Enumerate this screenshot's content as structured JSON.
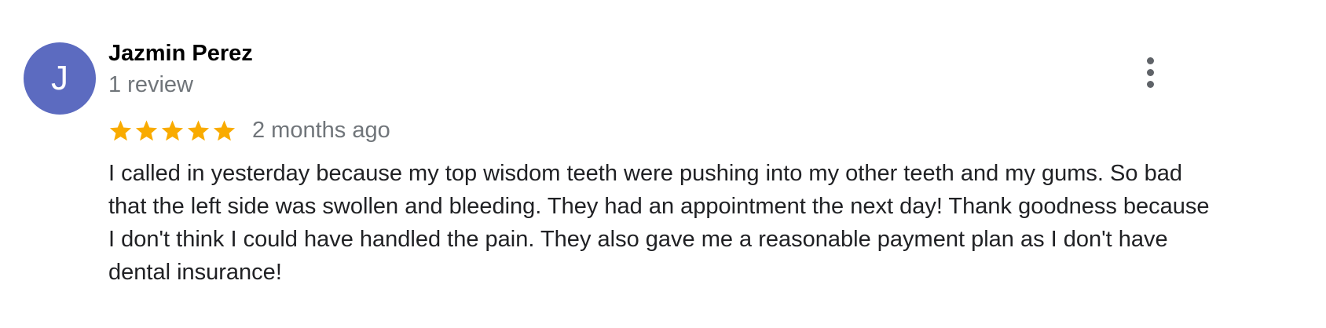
{
  "theme": {
    "avatar_color": "#5c6bc0",
    "star_color": "#f9ab00",
    "secondary_text_color": "#70757a"
  },
  "review": {
    "avatar_letter": "J",
    "author_name": "Jazmin Perez",
    "review_count": "1 review",
    "rating": 5,
    "rating_max": 5,
    "date": "2 months ago",
    "text": "I called in yesterday because my top wisdom teeth were pushing into my other teeth and my gums. So bad that the left side was swollen and bleeding. They had an appointment the next day! Thank goodness because I don't think I could have handled the pain. They also gave me a reasonable payment plan as I don't have dental insurance!",
    "more_icon": "more-vert-icon",
    "star_icon": "star-icon"
  }
}
